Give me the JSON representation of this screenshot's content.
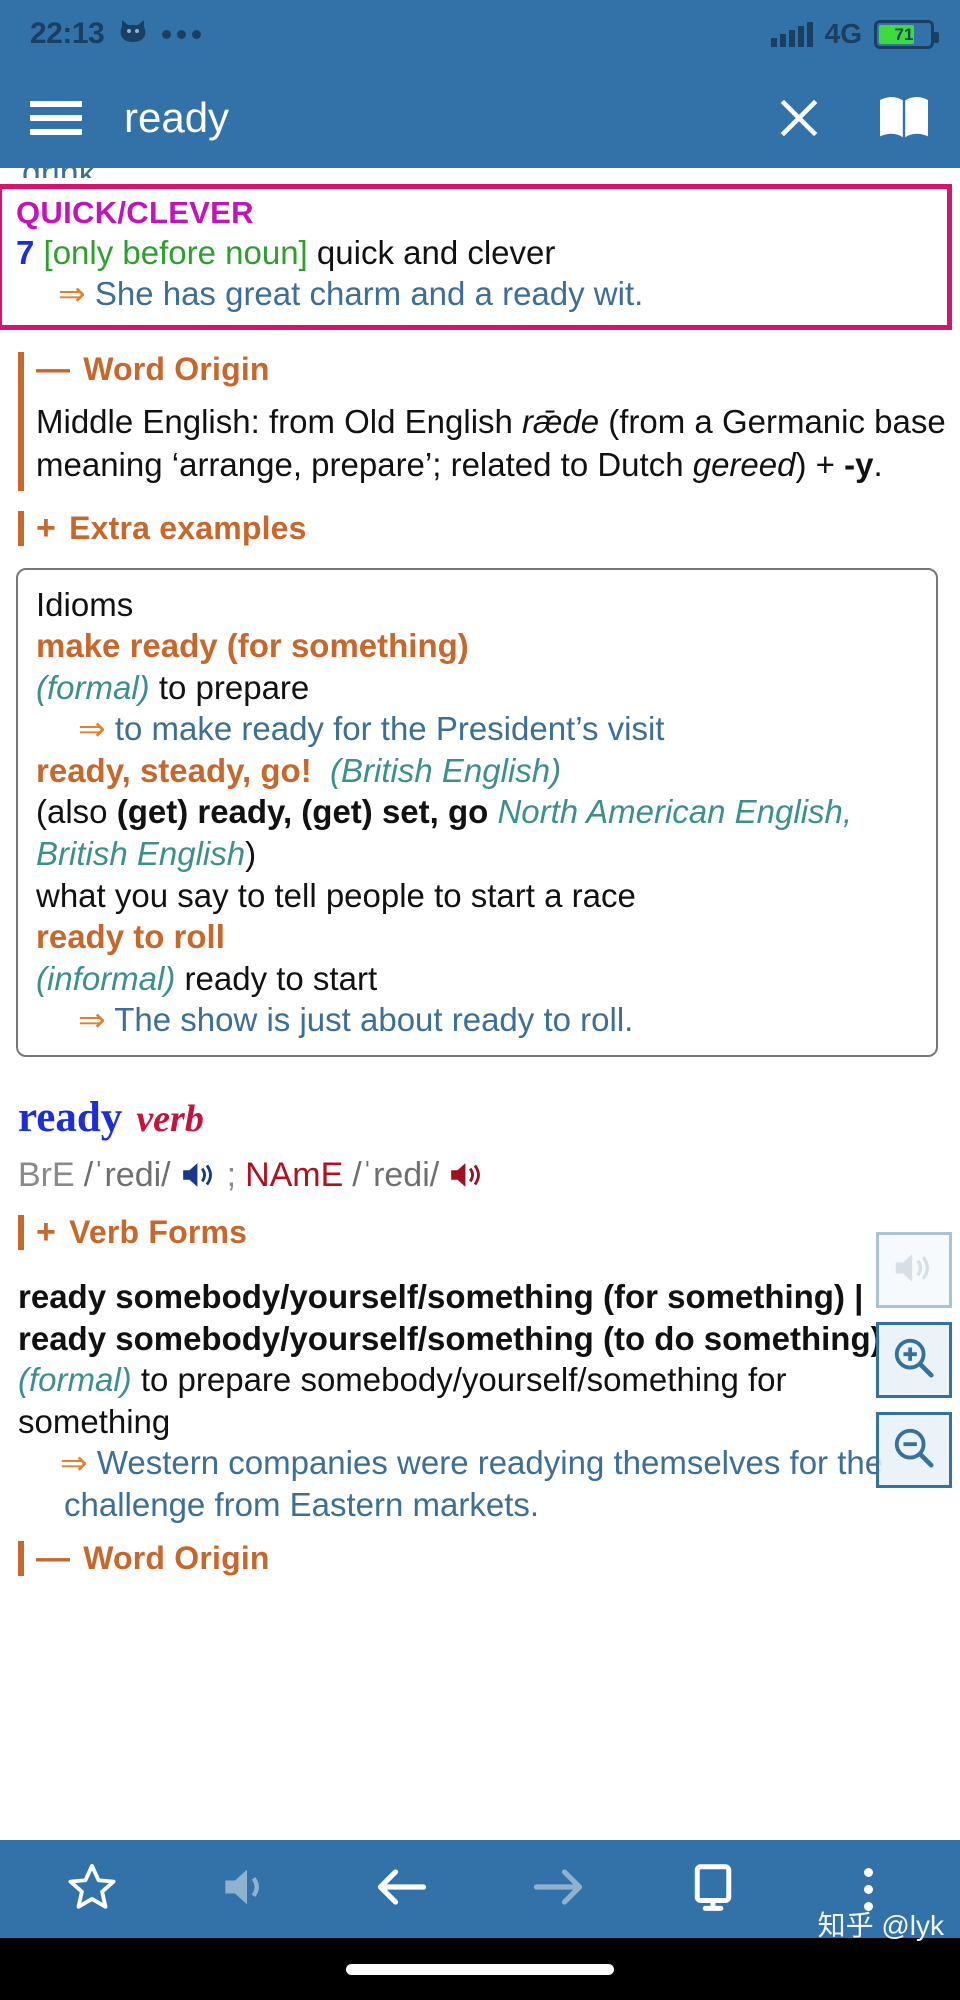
{
  "status_bar": {
    "time": "22:13",
    "cat_icon": "cat-icon",
    "dots_icon": "more-dots-icon",
    "signal_icon": "signal-bars-icon",
    "network": "4G",
    "battery_level": "71"
  },
  "app_bar": {
    "menu_icon": "hamburger-menu-icon",
    "title": "ready",
    "close_icon": "close-icon",
    "book_icon": "open-book-icon"
  },
  "content": {
    "cut_off_line": "drink.",
    "highlighted_sense": {
      "category": "QUICK/CLEVER",
      "number": "7",
      "grammar": "[only before noun]",
      "definition": "quick and clever",
      "example_arrow": "⇒",
      "example": "She has great charm and a ready wit."
    },
    "word_origin_adj": {
      "toggle": "—",
      "title": "Word Origin",
      "text_parts": {
        "p1": "Middle English: from Old English ",
        "i1": "rǣde",
        "p2": " (from a Germanic base meaning ‘arrange, prepare’; related to Dutch ",
        "i2": "gereed",
        "p3": ") + ",
        "b1": "-y",
        "p4": "."
      }
    },
    "extra_examples": {
      "toggle": "+",
      "title": "Extra examples"
    },
    "idioms_box": {
      "label": "Idioms",
      "entries": [
        {
          "idiom": "make ready (for something)",
          "register": "(formal)",
          "definition": " to prepare",
          "example_arrow": "⇒",
          "example": " to make ready for the President’s visit"
        },
        {
          "idiom": "ready, steady, go!",
          "register": "(British English)",
          "variant_prefix": "(also ",
          "variant_bold": "(get) ready, (get) set, go",
          "variant_region": " North American English, British English",
          "variant_suffix": ")",
          "definition": "what you say to tell people to start a race"
        },
        {
          "idiom": "ready to roll",
          "register": "(informal)",
          "definition": " ready to start",
          "example_arrow": "⇒",
          "example": " The show is just about ready to roll."
        }
      ]
    },
    "verb_entry": {
      "headword": "ready",
      "part_of_speech": "verb",
      "pronunciation": {
        "bre_label": "BrE",
        "bre_ipa": "/ˈredi/",
        "bre_speaker_icon": "speaker-blue-icon",
        "separator": ";",
        "name_label": "NAmE",
        "name_ipa": "/ˈredi/",
        "name_speaker_icon": "speaker-red-icon"
      },
      "verb_forms": {
        "toggle": "+",
        "title": "Verb Forms"
      },
      "pattern_1": "ready somebody/yourself/something (for something)",
      "pattern_sep": " | ",
      "pattern_2": "ready somebody/yourself/something (to do something)",
      "register": "(formal)",
      "definition": " to prepare somebody/yourself/something for something",
      "example_arrow": "⇒",
      "example": " Western companies were readying themselves for the challenge from Eastern markets."
    },
    "word_origin_verb": {
      "toggle": "—",
      "title": "Word Origin"
    }
  },
  "side_buttons": [
    {
      "name": "speaker-button",
      "icon": "speaker-icon",
      "state": "disabled"
    },
    {
      "name": "zoom-in-button",
      "icon": "magnifier-plus-icon",
      "state": "enabled"
    },
    {
      "name": "zoom-out-button",
      "icon": "magnifier-minus-icon",
      "state": "enabled"
    }
  ],
  "bottom_bar": {
    "items": [
      {
        "name": "favourite-button",
        "icon": "star-outline-icon",
        "state": "enabled"
      },
      {
        "name": "pronounce-button",
        "icon": "speaker-icon",
        "state": "disabled"
      },
      {
        "name": "back-button",
        "icon": "arrow-left-icon",
        "state": "enabled"
      },
      {
        "name": "forward-button",
        "icon": "arrow-right-icon",
        "state": "disabled"
      },
      {
        "name": "display-button",
        "icon": "monitor-icon",
        "state": "enabled"
      },
      {
        "name": "overflow-menu-button",
        "icon": "kebab-menu-icon",
        "state": "enabled"
      }
    ],
    "watermark": "知乎 @lyk"
  },
  "colors": {
    "app_bar": "#3272a8",
    "highlight_border": "#d4146e",
    "sense_category": "#c413b9",
    "sense_number": "#1c2fd6",
    "grammar_label": "#2e9e2e",
    "example_text": "#3c6e96",
    "section_accent": "#c8672b",
    "register_label": "#3c8f8a",
    "headword": "#1c2fd6",
    "part_of_speech": "#c4143c",
    "battery_fill": "#3ddc3d"
  }
}
